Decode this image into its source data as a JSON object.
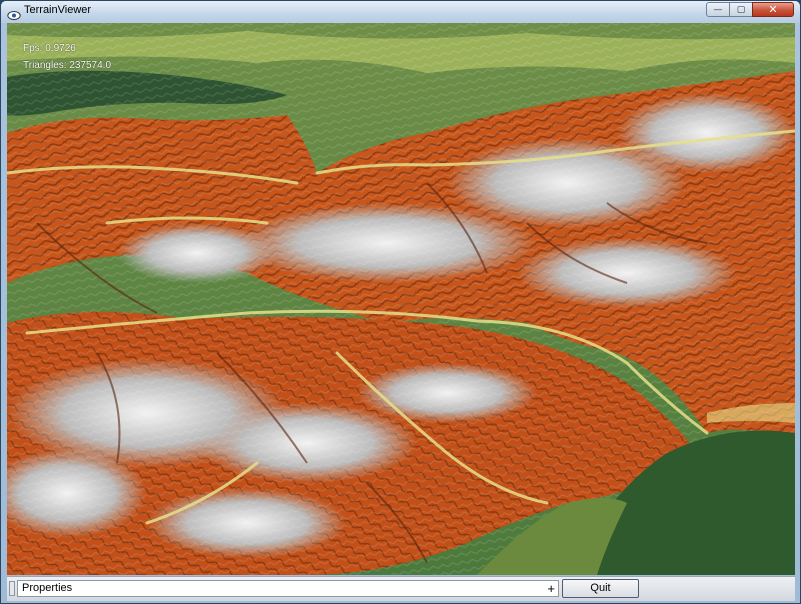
{
  "window": {
    "title": "TerrainViewer"
  },
  "controls": {
    "minimize": "—",
    "maximize": "▢",
    "close": "✕"
  },
  "hud": {
    "fps": "Fps: 0.9726",
    "triangles": "Triangles: 237574.0"
  },
  "footer": {
    "properties_label": "Properties",
    "properties_toggle": "+",
    "quit_label": "Quit"
  },
  "colors": {
    "terrain_lowland": "#4c7a3c",
    "terrain_lake": "#2e5432",
    "terrain_midslope": "#c8561a",
    "terrain_ridge_dark": "#5a2410",
    "terrain_snow": "#e8e8e8",
    "terrain_valley_light": "#e6e08a"
  }
}
